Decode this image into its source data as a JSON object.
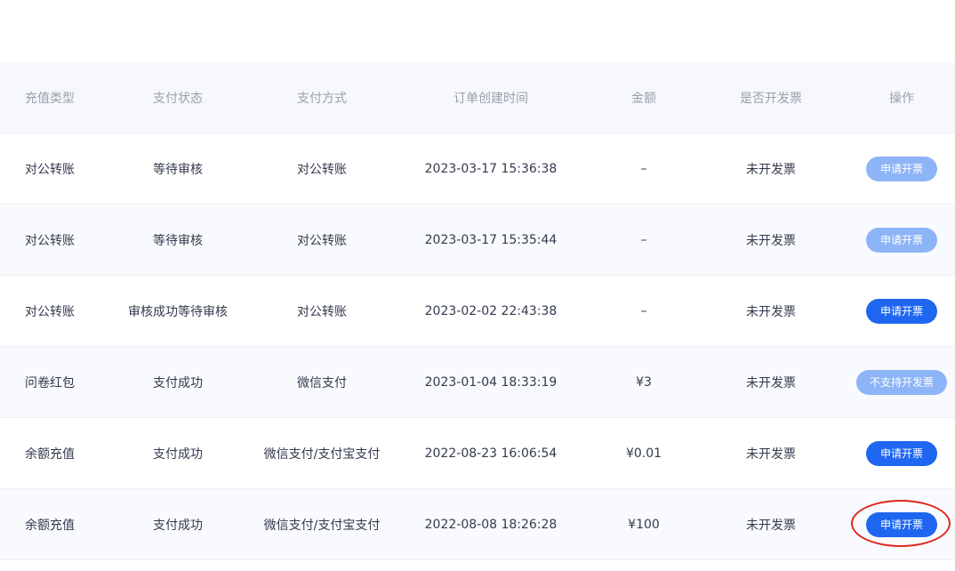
{
  "table": {
    "headers": [
      "充值类型",
      "支付状态",
      "支付方式",
      "订单创建时间",
      "金额",
      "是否开发票",
      "操作"
    ],
    "rows": [
      {
        "type": "对公转账",
        "status": "等待审核",
        "method": "对公转账",
        "created": "2023-03-17 15:36:38",
        "amount": "–",
        "invoice": "未开发票",
        "action": "申请开票",
        "action_enabled": false
      },
      {
        "type": "对公转账",
        "status": "等待审核",
        "method": "对公转账",
        "created": "2023-03-17 15:35:44",
        "amount": "–",
        "invoice": "未开发票",
        "action": "申请开票",
        "action_enabled": false
      },
      {
        "type": "对公转账",
        "status": "审核成功等待审核",
        "method": "对公转账",
        "created": "2023-02-02 22:43:38",
        "amount": "–",
        "invoice": "未开发票",
        "action": "申请开票",
        "action_enabled": true
      },
      {
        "type": "问卷红包",
        "status": "支付成功",
        "method": "微信支付",
        "created": "2023-01-04 18:33:19",
        "amount": "¥3",
        "invoice": "未开发票",
        "action": "不支持开发票",
        "action_enabled": false
      },
      {
        "type": "余额充值",
        "status": "支付成功",
        "method": "微信支付/支付宝支付",
        "created": "2022-08-23 16:06:54",
        "amount": "¥0.01",
        "invoice": "未开发票",
        "action": "申请开票",
        "action_enabled": true
      },
      {
        "type": "余额充值",
        "status": "支付成功",
        "method": "微信支付/支付宝支付",
        "created": "2022-08-08 18:26:28",
        "amount": "¥100",
        "invoice": "未开发票",
        "action": "申请开票",
        "action_enabled": true
      }
    ]
  },
  "colors": {
    "primary_button": "#1f66f0",
    "disabled_button": "#8db4f6",
    "highlight_circle": "#e0261d",
    "header_bg": "#f7f8fc"
  }
}
